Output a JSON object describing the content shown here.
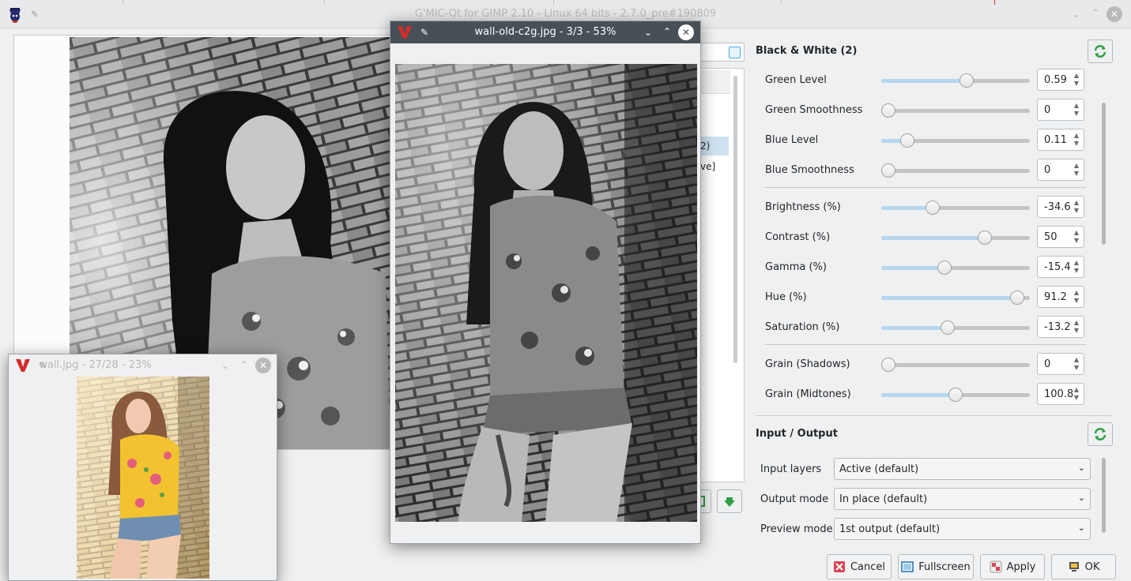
{
  "main_window": {
    "title": "G'MIC-Qt for GIMP 2.10 - Linux 64 bits - 2.7.0_pre#190809"
  },
  "filter_tree": {
    "rows": [
      "2)",
      "ve]"
    ]
  },
  "bw_section": {
    "title": "Black & White (2)",
    "params": [
      {
        "label": "Green Level",
        "value": "0.59",
        "fraction": 0.58
      },
      {
        "label": "Green Smoothness",
        "value": "0",
        "fraction": 0.0
      },
      {
        "label": "Blue Level",
        "value": "0.11",
        "fraction": 0.14
      },
      {
        "label": "Blue Smoothness",
        "value": "0",
        "fraction": 0.0
      },
      {
        "label": "Brightness (%)",
        "value": "-34.6",
        "fraction": 0.33
      },
      {
        "label": "Contrast (%)",
        "value": "50",
        "fraction": 0.72
      },
      {
        "label": "Gamma (%)",
        "value": "-15.4",
        "fraction": 0.42
      },
      {
        "label": "Hue (%)",
        "value": "91.2",
        "fraction": 0.96
      },
      {
        "label": "Saturation (%)",
        "value": "-13.2",
        "fraction": 0.44
      },
      {
        "label": "Grain (Shadows)",
        "value": "0",
        "fraction": 0.0
      },
      {
        "label": "Grain (Midtones)",
        "value": "100.8",
        "fraction": 0.5
      }
    ]
  },
  "io_section": {
    "title": "Input / Output",
    "rows": [
      {
        "label": "Input layers",
        "value": "Active (default)"
      },
      {
        "label": "Output mode",
        "value": "In place (default)"
      },
      {
        "label": "Preview mode",
        "value": "1st output (default)"
      }
    ]
  },
  "buttons": {
    "cancel": "Cancel",
    "fullscreen": "Fullscreen",
    "apply": "Apply",
    "ok": "OK"
  },
  "windows": {
    "bw_view": {
      "title": "wall-old-c2g.jpg - 3/3 - 53%"
    },
    "color_view": {
      "title": "wall.jpg - 27/28 - 23%"
    }
  },
  "colors": {
    "accent": "#3daee9",
    "slider_fill": "#b5d7f0",
    "selection": "#cfe2f3",
    "close_red": "#da4453"
  }
}
